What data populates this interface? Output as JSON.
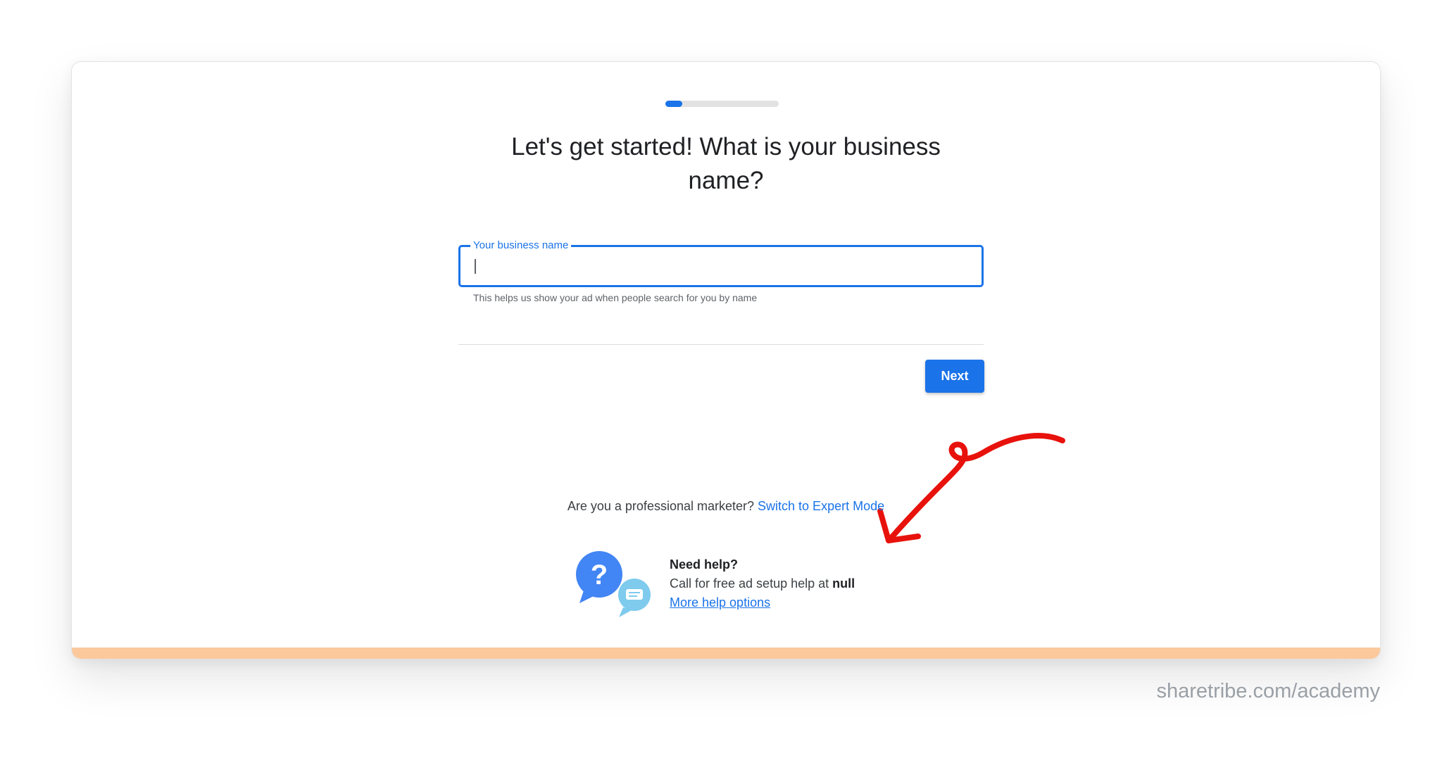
{
  "wizard": {
    "progress_percent": 15,
    "title": "Let's get started! What is your business name?"
  },
  "business_name_field": {
    "label": "Your business name",
    "value": "",
    "helper": "This helps us show your ad when people search for you by name"
  },
  "actions": {
    "next_label": "Next"
  },
  "expert_mode": {
    "prompt": "Are you a professional marketer?",
    "link": "Switch to Expert Mode"
  },
  "help": {
    "title": "Need help?",
    "call_text": "Call for free ad setup help at",
    "number": "null",
    "more_link": "More help options"
  },
  "watermark": "sharetribe.com/academy",
  "colors": {
    "accent": "#1a73e8",
    "annotation": "#e8120c",
    "card_bottom_bar": "#fbc99c"
  },
  "icons": {
    "help": "help-chat-bubbles-icon",
    "annotation": "hand-drawn-arrow"
  }
}
